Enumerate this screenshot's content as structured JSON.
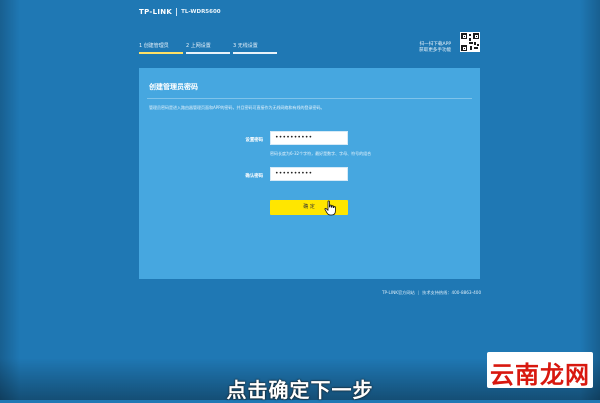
{
  "header": {
    "brand": "TP-LINK",
    "model": "TL-WDR5600"
  },
  "steps": [
    {
      "label": "1 创建管理员",
      "active": true
    },
    {
      "label": "2 上网设置",
      "active": false
    },
    {
      "label": "3 无线设置",
      "active": false
    }
  ],
  "app_promo": {
    "line1": "扫一扫下载APP",
    "line2": "获取更多手功能"
  },
  "panel": {
    "title": "创建管理员密码",
    "description": "管理员密码是进入路由器管理页面和APP的密码，并且密码可直接作为无线网络和有线的登录密码。"
  },
  "form": {
    "password_label": "设置密码",
    "password_value": "••••••••••",
    "password_hint": "密码长度为6-32个字符，最好是数字、字母、符号的组合",
    "confirm_label": "确认密码",
    "confirm_value": "••••••••••",
    "confirm_button": "确 定"
  },
  "footer": {
    "website": "TP-LINK官方网站",
    "hotline": "技术支持热线：400-8863-400"
  },
  "caption": "点击确定下一步",
  "watermark": "云南龙网",
  "colors": {
    "background": "#1f78b4",
    "panel": "#46a7e0",
    "active_step": "#ffe066",
    "button": "#ffe600",
    "watermark_text": "#d8180f"
  },
  "icons": [
    "qr-code-icon",
    "hand-cursor-icon"
  ]
}
